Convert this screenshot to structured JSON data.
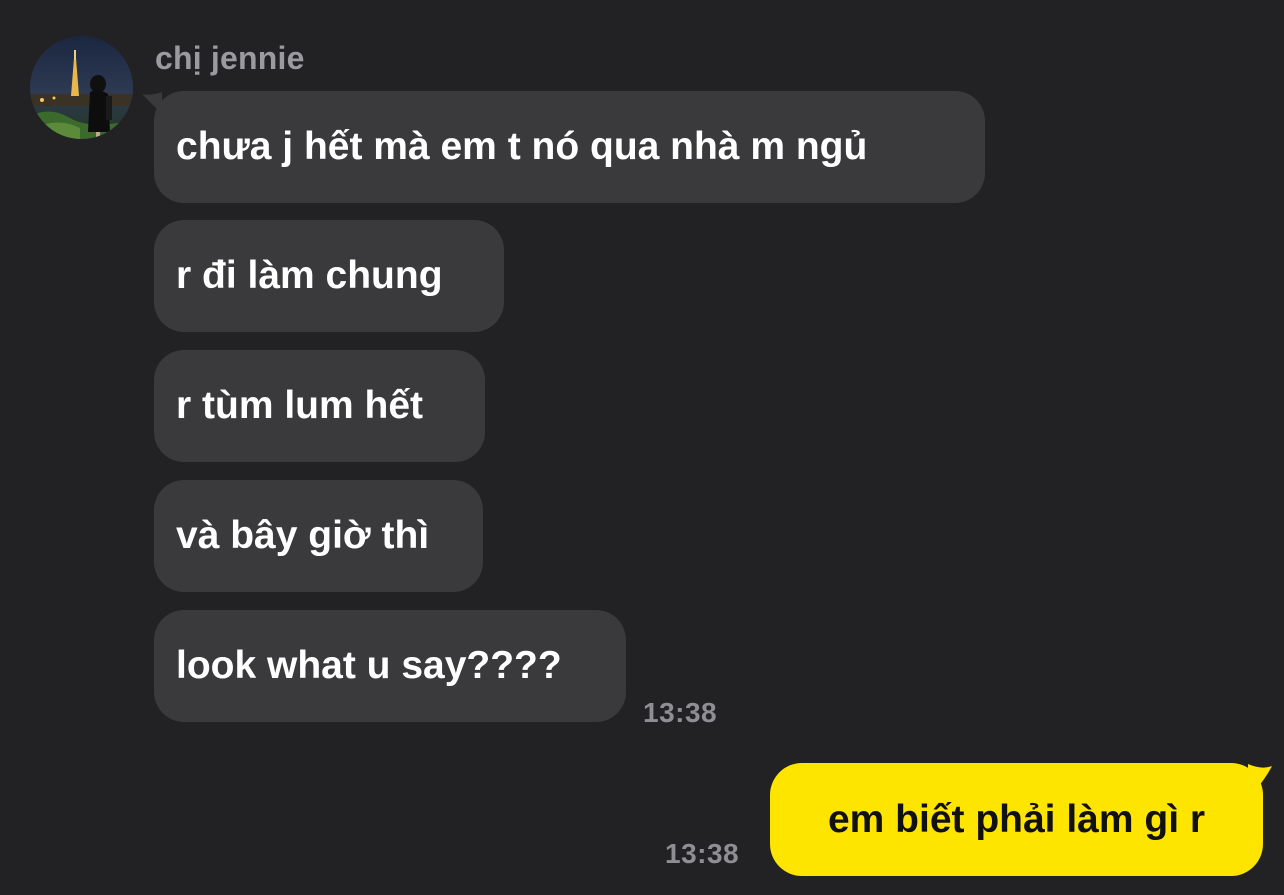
{
  "conversation": {
    "sender": {
      "name": "chị jennie",
      "avatar_icon": "profile-photo"
    },
    "incoming": [
      {
        "text": "chưa j hết mà em t nó qua nhà m ngủ"
      },
      {
        "text": "r đi làm chung"
      },
      {
        "text": "r tùm lum hết"
      },
      {
        "text": "và bây giờ thì"
      },
      {
        "text": "look what u say????"
      }
    ],
    "incoming_time": "13:38",
    "outgoing": [
      {
        "text": "em biết phải làm gì r"
      }
    ],
    "outgoing_time": "13:38"
  },
  "colors": {
    "background": "#222224",
    "incoming_bubble": "#3a3a3c",
    "outgoing_bubble": "#fee500",
    "muted_text": "#8e8e93"
  }
}
